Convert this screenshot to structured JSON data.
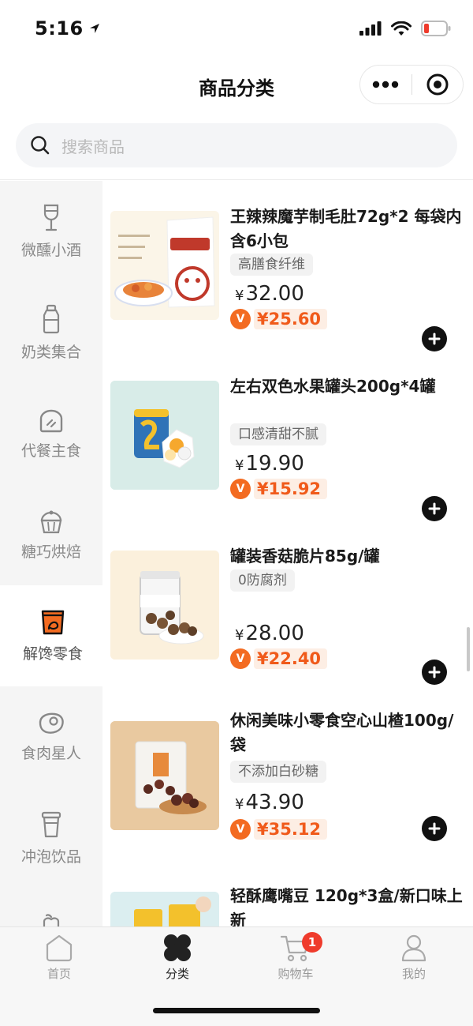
{
  "status_bar": {
    "time": "5:16"
  },
  "nav": {
    "title": "商品分类"
  },
  "search": {
    "placeholder": "搜索商品"
  },
  "sidebar": {
    "items": [
      {
        "label": "微醺小酒",
        "icon": "wine-glass-icon"
      },
      {
        "label": "奶类集合",
        "icon": "milk-bottle-icon"
      },
      {
        "label": "代餐主食",
        "icon": "bread-icon"
      },
      {
        "label": "糖巧烘焙",
        "icon": "cupcake-icon"
      },
      {
        "label": "解馋零食",
        "icon": "snack-bag-icon",
        "active": true
      },
      {
        "label": "食肉星人",
        "icon": "steak-icon"
      },
      {
        "label": "冲泡饮品",
        "icon": "cup-icon"
      },
      {
        "label": "",
        "icon": "fruit-icon"
      }
    ]
  },
  "products": [
    {
      "title": "王辣辣魔芋制毛肚72g*2 每袋内含6小包",
      "tag": "高膳食纤维",
      "price": "32.00",
      "vip_price": "¥25.60"
    },
    {
      "title": "左右双色水果罐头200g*4罐",
      "tag": "口感清甜不腻",
      "price": "19.90",
      "vip_price": "¥15.92"
    },
    {
      "title": "罐装香菇脆片85g/罐",
      "tag": "0防腐剂",
      "price": "28.00",
      "vip_price": "¥22.40"
    },
    {
      "title": "休闲美味小零食空心山楂100g/袋",
      "tag": "不添加白砂糖",
      "price": "43.90",
      "vip_price": "¥35.12"
    },
    {
      "title": "轻酥鹰嘴豆 120g*3盒/新口味上新"
    }
  ],
  "currency_symbol": "¥",
  "vip_badge": "V",
  "tab_bar": {
    "tabs": [
      {
        "label": "首页"
      },
      {
        "label": "分类"
      },
      {
        "label": "购物车"
      },
      {
        "label": "我的"
      }
    ],
    "cart_count": "1"
  },
  "colors": {
    "accent": "#f36b21",
    "vip_price": "#f05a1a",
    "badge": "#ef3b2c"
  }
}
